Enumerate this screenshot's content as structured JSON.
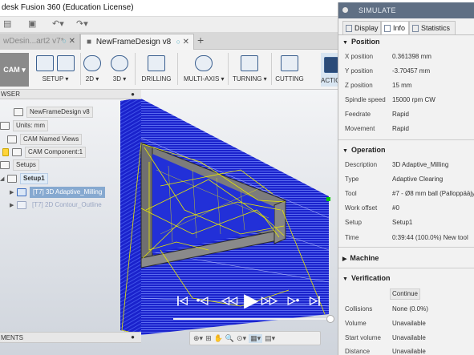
{
  "window": {
    "title": "desk Fusion 360 (Education License)"
  },
  "tabs": [
    {
      "label": "wDesin...art2 v7*"
    },
    {
      "label": "NewFrameDesign v8"
    }
  ],
  "ribbon": {
    "workspace": "CAM",
    "groups": [
      "SETUP",
      "2D",
      "3D",
      "DRILLING",
      "MULTI-AXIS",
      "TURNING",
      "CUTTING",
      "ACTION"
    ]
  },
  "browser": {
    "title": "WSER",
    "nodes": [
      {
        "label": "NewFrameDesign v8"
      },
      {
        "label": "Units: mm"
      },
      {
        "label": "CAM Named Views"
      },
      {
        "label": "CAM Component:1"
      },
      {
        "label": "Setups"
      },
      {
        "label": "Setup1"
      },
      {
        "label": "[T7] 3D Adaptive_Milling"
      },
      {
        "label": "[T7] 2D Contour_Outline"
      }
    ]
  },
  "comments": {
    "title": "MENTS"
  },
  "player": {
    "buttons": [
      "|◁",
      "•◁",
      "◁◁",
      "▶",
      "▷▷",
      "▷•",
      "▷|"
    ],
    "position_fraction": 1.0
  },
  "simulate": {
    "header": "SIMULATE",
    "tabs": [
      {
        "label": "Display"
      },
      {
        "label": "Info"
      },
      {
        "label": "Statistics"
      }
    ],
    "position": {
      "title": "Position",
      "rows": [
        {
          "k": "X position",
          "v": "0.361398 mm"
        },
        {
          "k": "Y position",
          "v": "-3.70457 mm"
        },
        {
          "k": "Z position",
          "v": "15 mm"
        },
        {
          "k": "Spindle speed",
          "v": "15000 rpm CW"
        },
        {
          "k": "Feedrate",
          "v": "Rapid"
        },
        {
          "k": "Movement",
          "v": "Rapid"
        }
      ]
    },
    "operation": {
      "title": "Operation",
      "rows": [
        {
          "k": "Description",
          "v": "3D Adaptive_Milling"
        },
        {
          "k": "Type",
          "v": "Adaptive Clearing"
        },
        {
          "k": "Tool",
          "v": "#7 - Ø8 mm ball (Palloppääjyr..."
        },
        {
          "k": "Work offset",
          "v": "#0"
        },
        {
          "k": "Setup",
          "v": "Setup1"
        },
        {
          "k": "Time",
          "v": "0:39:44 (100.0%) New tool"
        }
      ]
    },
    "machine": {
      "title": "Machine"
    },
    "verification": {
      "title": "Verification",
      "continue_label": "Continue",
      "rows": [
        {
          "k": "Collisions",
          "v": "None (0.0%)"
        },
        {
          "k": "Volume",
          "v": "Unavailable"
        },
        {
          "k": "Start volume",
          "v": "Unavailable"
        },
        {
          "k": "Distance",
          "v": "Unavailable"
        }
      ]
    }
  },
  "colors": {
    "toolpath_blue": "#1a22cc",
    "rapid_yellow": "#e8e800",
    "stock_grey": "#7c7c7c",
    "selection": "#86a9d0",
    "panel_header": "#5f6f84"
  }
}
